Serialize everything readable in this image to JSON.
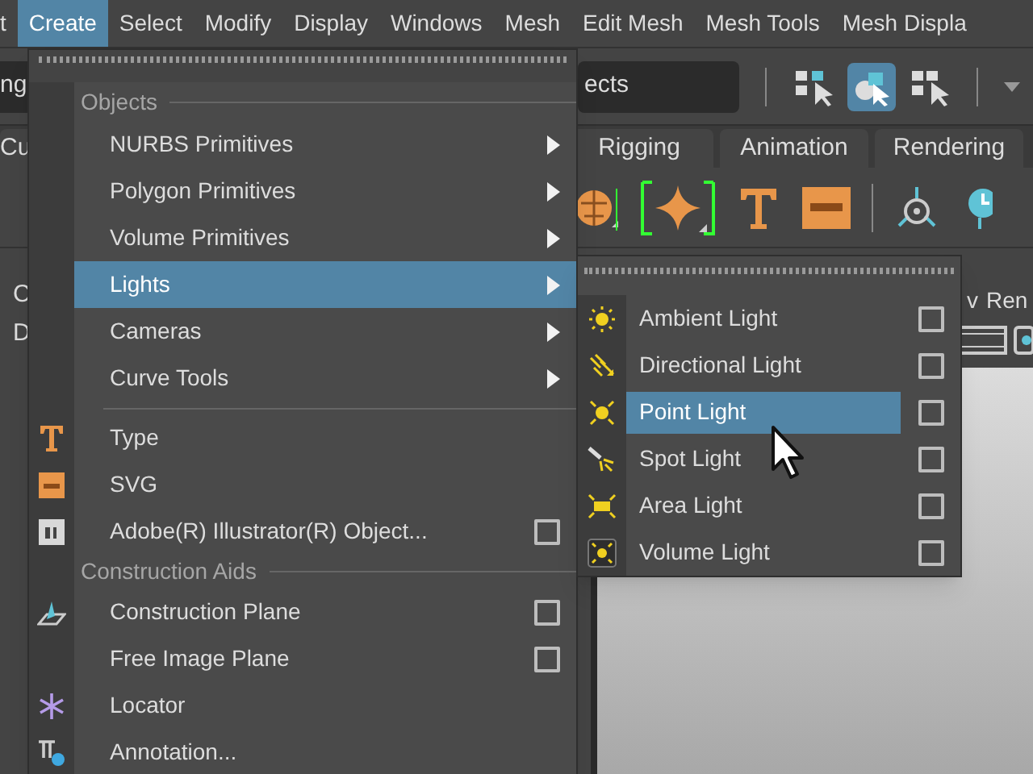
{
  "menu_bar": [
    {
      "label": "t",
      "selected": false
    },
    {
      "label": "Create",
      "selected": true
    },
    {
      "label": "Select",
      "selected": false
    },
    {
      "label": "Modify",
      "selected": false
    },
    {
      "label": "Display",
      "selected": false
    },
    {
      "label": "Windows",
      "selected": false
    },
    {
      "label": "Mesh",
      "selected": false
    },
    {
      "label": "Edit Mesh",
      "selected": false
    },
    {
      "label": "Mesh Tools",
      "selected": false
    },
    {
      "label": "Mesh Displa",
      "selected": false
    }
  ],
  "toolbar": {
    "left_field": "ng",
    "selection_field": "ects"
  },
  "shelf_tabs": [
    {
      "label": "Cu",
      "selected": false
    },
    {
      "label": "Rigging",
      "selected": false
    },
    {
      "label": "Animation",
      "selected": false
    },
    {
      "label": "Rendering",
      "selected": false
    }
  ],
  "side_panel": {
    "labels": [
      "C",
      "D"
    ]
  },
  "viewport_menu": [
    "v",
    "Ren"
  ],
  "create_menu": {
    "items": [
      {
        "kind": "header",
        "label": "Objects"
      },
      {
        "kind": "submenu",
        "label": "NURBS Primitives",
        "selected": false
      },
      {
        "kind": "submenu",
        "label": "Polygon Primitives",
        "selected": false
      },
      {
        "kind": "submenu",
        "label": "Volume Primitives",
        "selected": false
      },
      {
        "kind": "submenu",
        "label": "Lights",
        "selected": true
      },
      {
        "kind": "submenu",
        "label": "Cameras",
        "selected": false
      },
      {
        "kind": "submenu",
        "label": "Curve Tools",
        "selected": false
      },
      {
        "kind": "separator"
      },
      {
        "kind": "item",
        "label": "Type",
        "selected": false,
        "option_box": false
      },
      {
        "kind": "item",
        "label": "SVG",
        "selected": false,
        "option_box": false
      },
      {
        "kind": "item",
        "label": "Adobe(R) Illustrator(R) Object...",
        "selected": false,
        "option_box": true
      },
      {
        "kind": "header",
        "label": "Construction Aids"
      },
      {
        "kind": "item",
        "label": "Construction Plane",
        "selected": false,
        "option_box": true
      },
      {
        "kind": "item",
        "label": "Free Image Plane",
        "selected": false,
        "option_box": true
      },
      {
        "kind": "item",
        "label": "Locator",
        "selected": false,
        "option_box": false
      },
      {
        "kind": "item",
        "label": "Annotation...",
        "selected": false,
        "option_box": false
      }
    ]
  },
  "lights_menu": {
    "items": [
      {
        "label": "Ambient Light",
        "selected": false,
        "option_box": true
      },
      {
        "label": "Directional Light",
        "selected": false,
        "option_box": true
      },
      {
        "label": "Point Light",
        "selected": true,
        "option_box": true
      },
      {
        "label": "Spot Light",
        "selected": false,
        "option_box": true
      },
      {
        "label": "Area Light",
        "selected": false,
        "option_box": true
      },
      {
        "label": "Volume Light",
        "selected": false,
        "option_box": true
      }
    ]
  }
}
